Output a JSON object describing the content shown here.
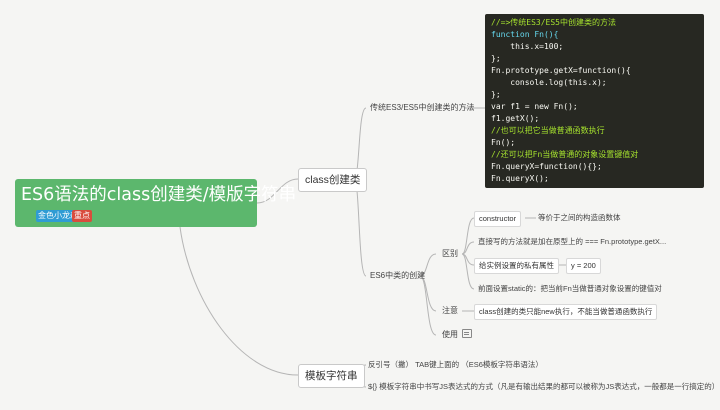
{
  "root": {
    "title": "ES6语法的class创建类/模版字符串",
    "badges": [
      "金色小龙森",
      "重点"
    ]
  },
  "branches": {
    "class_create": {
      "label": "class创建类",
      "traditional": {
        "label": "传统ES3/ES5中创建类的方法",
        "code_lines": [
          "//=>传统ES3/ES5中创建类的方法",
          "function Fn(){",
          "    this.x=100;",
          "};",
          "Fn.prototype.getX=function(){",
          "    console.log(this.x);",
          "};",
          "var f1 = new Fn();",
          "f1.getX();",
          "//也可以把它当做普通函数执行",
          "Fn();",
          "//还可以把Fn当做普通的对象设置键值对",
          "Fn.queryX=function(){};",
          "Fn.queryX();"
        ]
      },
      "es6": {
        "label": "ES6中类的创建",
        "difference": {
          "label": "区别",
          "items": [
            {
              "label": "constructor",
              "detail": "等价于之间的构造函数体"
            },
            {
              "label": "直接写的方法就是加在原型上的 === Fn.prototype.getX..."
            },
            {
              "label": "给实例设置的私有属性",
              "detail": "y = 200"
            },
            {
              "label": "前面设置static的：把当前Fn当做普通对象设置的键值对"
            }
          ]
        },
        "note": {
          "label": "注意",
          "detail": "class创建的类只能new执行，不能当做普通函数执行"
        },
        "usage": {
          "label": "使用"
        }
      }
    },
    "template_string": {
      "label": "模板字符串",
      "items": [
        "反引号（撇） TAB键上面的 （ES6模板字符串语法）",
        "${} 模板字符串中书写JS表达式的方式（凡是有输出结果的都可以被称为JS表达式，一般都是一行搞定的）"
      ]
    }
  }
}
